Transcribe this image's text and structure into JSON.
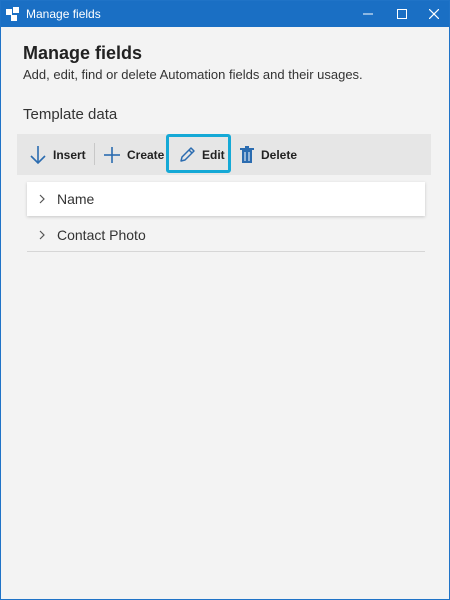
{
  "window": {
    "title": "Manage fields",
    "controls": {
      "minimize": "minimize",
      "maximize": "maximize",
      "close": "close"
    }
  },
  "header": {
    "title": "Manage fields",
    "subtitle": "Add, edit, find or delete Automation fields and their usages."
  },
  "section": {
    "title": "Template data"
  },
  "toolbar": {
    "insert_label": "Insert",
    "create_label": "Create",
    "edit_label": "Edit",
    "delete_label": "Delete"
  },
  "tree": {
    "items": [
      {
        "label": "Name",
        "selected": true
      },
      {
        "label": "Contact Photo",
        "selected": false
      }
    ]
  },
  "colors": {
    "titlebar": "#1a6fc4",
    "highlight": "#15a9d6",
    "icon_blue": "#2b6cb0"
  }
}
